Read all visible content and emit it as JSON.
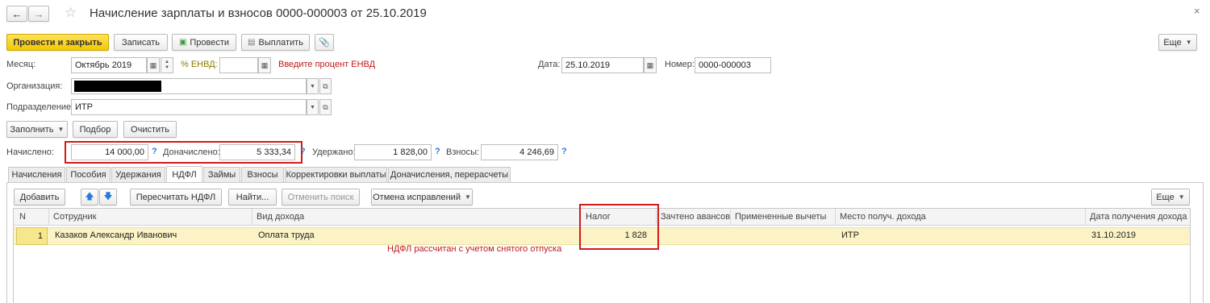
{
  "window": {
    "title": "Начисление зарплаты и взносов 0000-000003 от 25.10.2019"
  },
  "toolbar": {
    "post_close": "Провести и закрыть",
    "save": "Записать",
    "post": "Провести",
    "pay": "Выплатить",
    "more": "Еще"
  },
  "header": {
    "month_label": "Месяц:",
    "month_value": "Октябрь 2019",
    "envd_label": "% ЕНВД:",
    "envd_value": "",
    "envd_warning": "Введите процент ЕНВД",
    "date_label": "Дата:",
    "date_value": "25.10.2019",
    "number_label": "Номер:",
    "number_value": "0000-000003",
    "org_label": "Организация:",
    "dept_label": "Подразделение:",
    "dept_value": "ИТР"
  },
  "actions": {
    "fill": "Заполнить",
    "select": "Подбор",
    "clear": "Очистить"
  },
  "totals": {
    "accrued_label": "Начислено:",
    "accrued_value": "14 000,00",
    "extra_label": "Доначислено:",
    "extra_value": "5 333,34",
    "withheld_label": "Удержано:",
    "withheld_value": "1 828,00",
    "contrib_label": "Взносы:",
    "contrib_value": "4 246,69",
    "help": "?"
  },
  "tabs": [
    "Начисления",
    "Пособия",
    "Удержания",
    "НДФЛ",
    "Займы",
    "Взносы",
    "Корректировки выплаты",
    "Доначисления, перерасчеты"
  ],
  "active_tab": "НДФЛ",
  "table_toolbar": {
    "add": "Добавить",
    "recalc": "Пересчитать НДФЛ",
    "find": "Найти...",
    "cancel_search": "Отменить поиск",
    "cancel_fixes": "Отмена исправлений",
    "more": "Еще"
  },
  "table": {
    "columns": [
      "N",
      "Сотрудник",
      "Вид дохода",
      "Налог",
      "Зачтено авансов",
      "Примененные вычеты",
      "Место получ. дохода",
      "Дата получения дохода"
    ],
    "rows": [
      {
        "n": "1",
        "employee": "Казаков Александр Иванович",
        "income_type": "Оплата труда",
        "tax": "1 828",
        "advances": "",
        "deductions": "",
        "place": "ИТР",
        "date": "31.10.2019"
      }
    ]
  },
  "annotation": "НДФЛ рассчитан с учетом снятого отпуска",
  "colors": {
    "accent_yellow": "#f5c800",
    "annotation_red": "#d11a1a",
    "row_highlight": "#fbf3c6",
    "help_blue": "#2a7bd4"
  }
}
